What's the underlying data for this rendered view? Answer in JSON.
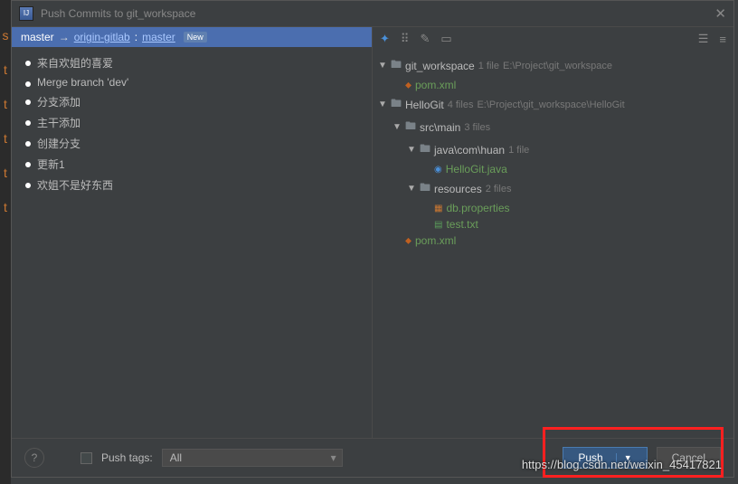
{
  "title": "Push Commits to git_workspace",
  "branch": {
    "local": "master",
    "arrow": "→",
    "remote": "origin-gitlab",
    "sep": " : ",
    "remote_branch": "master",
    "badge": "New"
  },
  "commits": [
    "来自欢姐的喜爱",
    "Merge branch 'dev'",
    "分支添加",
    "主干添加",
    "创建分支",
    "更新1",
    "欢姐不是好东西"
  ],
  "tree": {
    "root": {
      "name": "git_workspace",
      "meta": "1 file",
      "path": "E:\\Project\\git_workspace"
    },
    "root_pom": "pom.xml",
    "hello": {
      "name": "HelloGit",
      "meta": "4 files",
      "path": "E:\\Project\\git_workspace\\HelloGit"
    },
    "srcmain": {
      "name": "src\\main",
      "meta": "3 files"
    },
    "javapkg": {
      "name": "java\\com\\huan",
      "meta": "1 file"
    },
    "hellojava": "HelloGit.java",
    "resources": {
      "name": "resources",
      "meta": "2 files"
    },
    "dbprop": "db.properties",
    "testtxt": "test.txt",
    "pom2": "pom.xml"
  },
  "footer": {
    "push_tags_label": "Push tags:",
    "push_tags_value": "All",
    "push": "Push",
    "cancel": "Cancel"
  },
  "watermark": "https://blog.csdn.net/weixin_45417821",
  "edge_chars": [
    "s",
    "t",
    "t",
    "t",
    "t",
    "t"
  ]
}
